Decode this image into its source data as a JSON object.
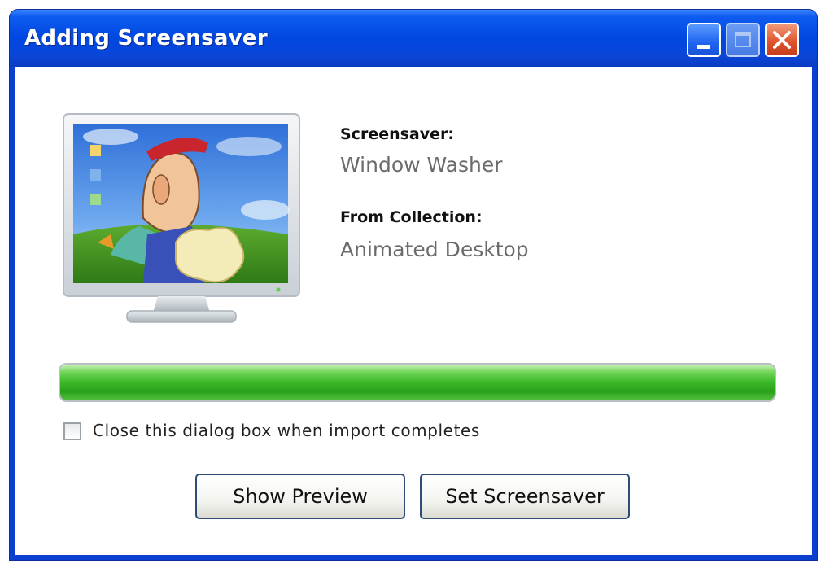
{
  "window": {
    "title": "Adding Screensaver",
    "controls": {
      "minimize": "minimize-icon",
      "maximize": "maximize-icon",
      "close": "close-icon"
    }
  },
  "preview": {
    "image": "monitor-with-window-washer-cartoon"
  },
  "info": {
    "screensaver_label": "Screensaver:",
    "screensaver_value": "Window Washer",
    "collection_label": "From Collection:",
    "collection_value": "Animated Desktop"
  },
  "progress": {
    "percent": 100,
    "color": "#3bb828"
  },
  "options": {
    "close_on_complete_label": "Close this dialog box when import completes",
    "close_on_complete_checked": false
  },
  "buttons": {
    "show_preview": "Show Preview",
    "set_screensaver": "Set Screensaver"
  },
  "colors": {
    "titlebar": "#0047e0",
    "close_button": "#e0552e",
    "button_border": "#2d4c7a"
  }
}
